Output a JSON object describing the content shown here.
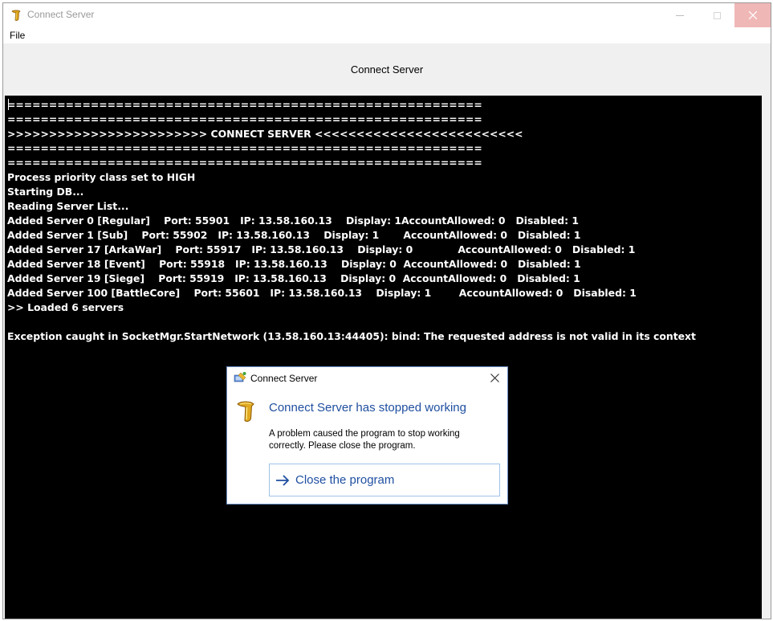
{
  "window": {
    "title": "Connect Server"
  },
  "menu": {
    "items": [
      {
        "label": "File"
      }
    ]
  },
  "header": {
    "label": "Connect Server"
  },
  "console": {
    "lines": [
      "=========================================================",
      "=========================================================",
      ">>>>>>>>>>>>>>>>>>>>>>>> CONNECT SERVER <<<<<<<<<<<<<<<<<<<<<<<<<",
      "=========================================================",
      "=========================================================",
      "Process priority class set to HIGH",
      "Starting DB...",
      "Reading Server List...",
      "Added Server 0 [Regular]    Port: 55901   IP: 13.58.160.13    Display: 1AccountAllowed: 0   Disabled: 1",
      "Added Server 1 [Sub]    Port: 55902   IP: 13.58.160.13    Display: 1       AccountAllowed: 0   Disabled: 1",
      "Added Server 17 [ArkaWar]    Port: 55917   IP: 13.58.160.13    Display: 0             AccountAllowed: 0   Disabled: 1",
      "Added Server 18 [Event]    Port: 55918   IP: 13.58.160.13    Display: 0  AccountAllowed: 0   Disabled: 1",
      "Added Server 19 [Siege]    Port: 55919   IP: 13.58.160.13    Display: 0  AccountAllowed: 0   Disabled: 1",
      "Added Server 100 [BattleCore]    Port: 55601   IP: 13.58.160.13    Display: 1        AccountAllowed: 0   Disabled: 1",
      ">> Loaded 6 servers",
      "",
      "Exception caught in SocketMgr.StartNetwork (13.58.160.13:44405): bind: The requested address is not valid in its context"
    ]
  },
  "dialog": {
    "title": "Connect Server",
    "heading": "Connect Server has stopped working",
    "body_line1": "A problem caused the program to stop working",
    "body_line2": "correctly. Please close the program.",
    "action_label": "Close the program"
  },
  "colors": {
    "console_bg": "#000000",
    "console_fg": "#ffffff",
    "dialog_heading": "#1f4fa0",
    "close_button_hover": "#f0b7b7"
  },
  "icons": {
    "app": "app-logo-icon",
    "dialog_title": "error-reporting-icon",
    "close": "close-icon",
    "action": "arrow-right-icon"
  }
}
